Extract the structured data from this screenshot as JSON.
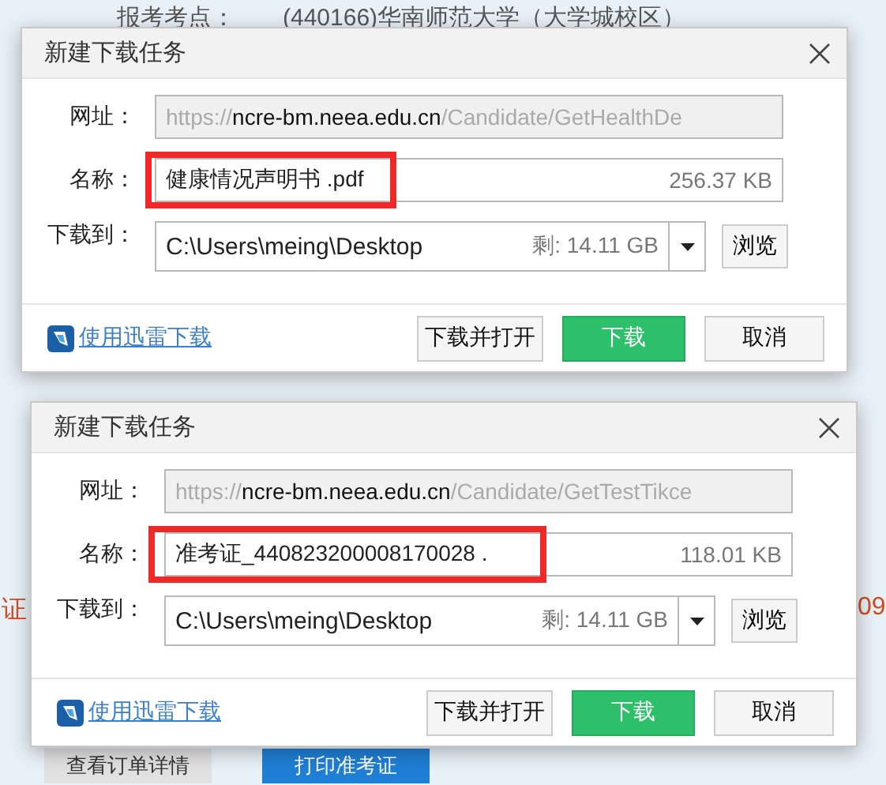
{
  "background": {
    "header_label": "报考考点：",
    "header_value": "(440166)华南师范大学（大学城校区）",
    "left_fragment": "证",
    "right_fragment": "09",
    "buttons": [
      {
        "label": "查看订单详情",
        "kind": "secondary"
      },
      {
        "label": "打印准考证",
        "kind": "primary"
      }
    ]
  },
  "dialogs": [
    {
      "title": "新建下载任务",
      "url": {
        "label": "网址：",
        "prefix": "https://",
        "host": "ncre-bm.neea.edu.cn",
        "path": "/Candidate/GetHealthDe"
      },
      "name": {
        "label": "名称：",
        "value": "健康情况声明书 .pdf",
        "size": "256.37 KB",
        "highlighted": true
      },
      "save": {
        "label": "下载到：",
        "path": "C:\\Users\\meing\\Desktop",
        "free": "剩: 14.11 GB",
        "browse": "浏览"
      },
      "thunder_link": "使用迅雷下载",
      "buttons": [
        {
          "label": "下载并打开",
          "kind": "secondary"
        },
        {
          "label": "下载",
          "kind": "primary"
        },
        {
          "label": "取消",
          "kind": "secondary"
        }
      ]
    },
    {
      "title": "新建下载任务",
      "url": {
        "label": "网址：",
        "prefix": "https://",
        "host": "ncre-bm.neea.edu.cn",
        "path": "/Candidate/GetTestTikce"
      },
      "name": {
        "label": "名称：",
        "value": "准考证_440823200008170028 .",
        "size": "118.01 KB",
        "highlighted": true
      },
      "save": {
        "label": "下载到：",
        "path": "C:\\Users\\meing\\Desktop",
        "free": "剩: 14.11 GB",
        "browse": "浏览"
      },
      "thunder_link": "使用迅雷下载",
      "buttons": [
        {
          "label": "下载并打开",
          "kind": "secondary"
        },
        {
          "label": "下载",
          "kind": "primary"
        },
        {
          "label": "取消",
          "kind": "secondary"
        }
      ]
    }
  ]
}
